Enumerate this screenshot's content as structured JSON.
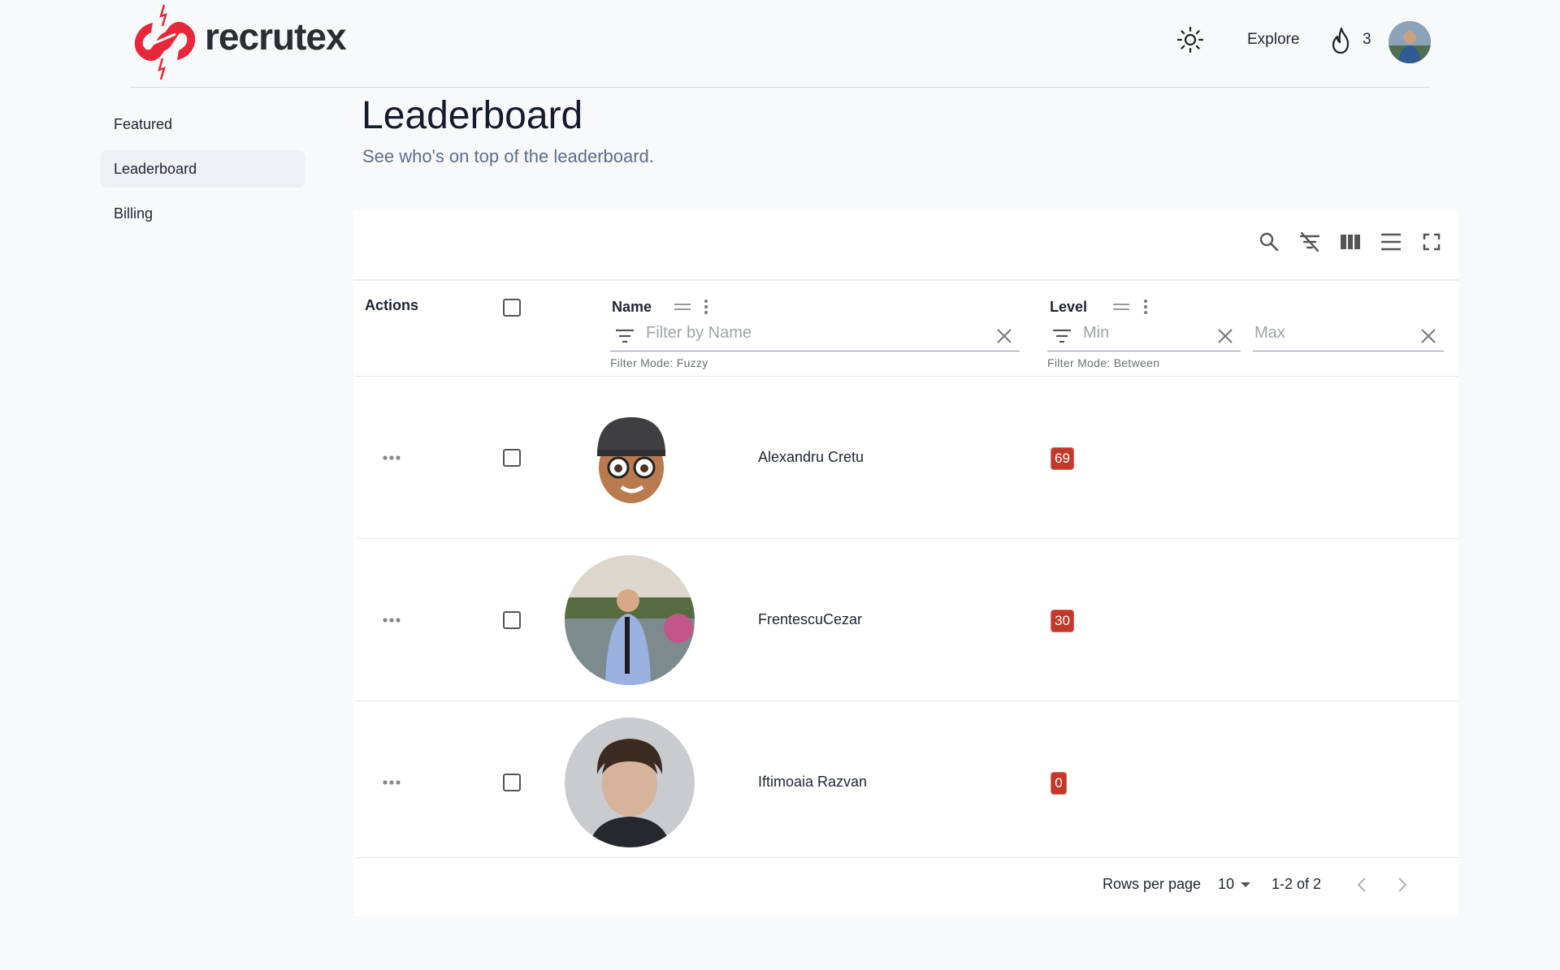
{
  "header": {
    "brand": "recrutex",
    "explore_label": "Explore",
    "streak_count": "3"
  },
  "sidebar": {
    "items": [
      {
        "label": "Featured",
        "active": false
      },
      {
        "label": "Leaderboard",
        "active": true
      },
      {
        "label": "Billing",
        "active": false
      }
    ]
  },
  "page": {
    "title": "Leaderboard",
    "subtitle": "See who's on top of the leaderboard."
  },
  "table": {
    "columns": {
      "actions": "Actions",
      "name": "Name",
      "level": "Level"
    },
    "filters": {
      "name_placeholder": "Filter by Name",
      "name_mode": "Filter Mode: Fuzzy",
      "level_min_placeholder": "Min",
      "level_max_placeholder": "Max",
      "level_mode": "Filter Mode: Between"
    },
    "rows": [
      {
        "name": "Alexandru Cretu",
        "level": "69"
      },
      {
        "name": "FrentescuCezar",
        "level": "30"
      },
      {
        "name": "Iftimoaia Razvan",
        "level": "0"
      }
    ],
    "footer": {
      "rows_per_page_label": "Rows per page",
      "rows_per_page_value": "10",
      "range": "1-2 of 2"
    }
  },
  "colors": {
    "accent_red": "#e8283a",
    "badge_red": "#c0392b"
  },
  "icons": [
    "logo-mark-icon",
    "sun-icon",
    "fire-icon",
    "search-icon",
    "filter-off-icon",
    "columns-icon",
    "density-icon",
    "fullscreen-icon",
    "drag-handle-icon",
    "kebab-menu-icon",
    "filter-list-icon",
    "close-icon",
    "more-horiz-icon",
    "chevron-left-icon",
    "chevron-right-icon",
    "caret-down-icon"
  ]
}
